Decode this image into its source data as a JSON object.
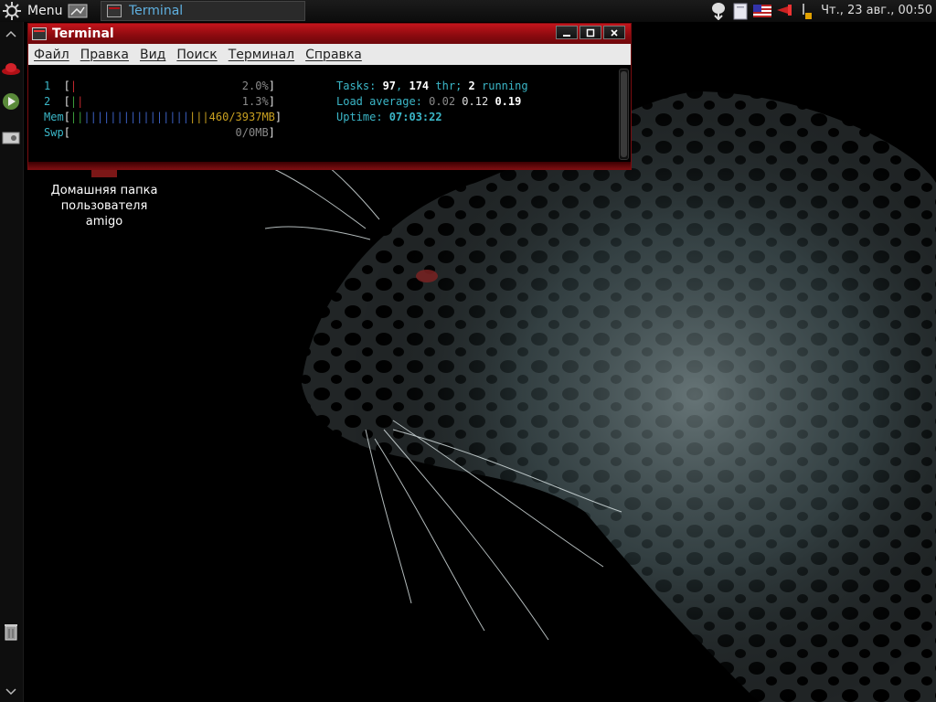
{
  "panel": {
    "menu_label": "Menu",
    "task_terminal_label": "Terminal",
    "clock": "Чт., 23 авг., 00:50",
    "tray_icons": [
      "download-icon",
      "clipboard-icon",
      "us-flag-keyboard-icon",
      "network-icon",
      "update-icon"
    ]
  },
  "desktop": {
    "home_folder_label_line1": "Домашняя папка",
    "home_folder_label_line2": "пользователя",
    "home_folder_label_line3": "amigo"
  },
  "terminal": {
    "title": "Terminal",
    "menu": [
      "Файл",
      "Правка",
      "Вид",
      "Поиск",
      "Терминал",
      "Справка"
    ],
    "cpu1_label": "1",
    "cpu1_value": "2.0%",
    "cpu2_label": "2",
    "cpu2_value": "1.3%",
    "mem_label": "Mem",
    "mem_value": "460/3937MB",
    "swp_label": "Swp",
    "swp_value": "0/0MB",
    "tasks_label": "Tasks: ",
    "tasks_count": "97",
    "tasks_sep": ", ",
    "threads_count": "174",
    "threads_label": " thr; ",
    "running_count": "2",
    "running_label": " running",
    "load_label": "Load average: ",
    "load_1": "0.02",
    "load_5": "0.12",
    "load_15": "0.19",
    "uptime_label": "Uptime: ",
    "uptime_value": "07:03:22"
  },
  "colors": {
    "title_bar": "#b01016",
    "htop_cyan": "#3bb7c8",
    "task_label": "#5fb0e0"
  }
}
